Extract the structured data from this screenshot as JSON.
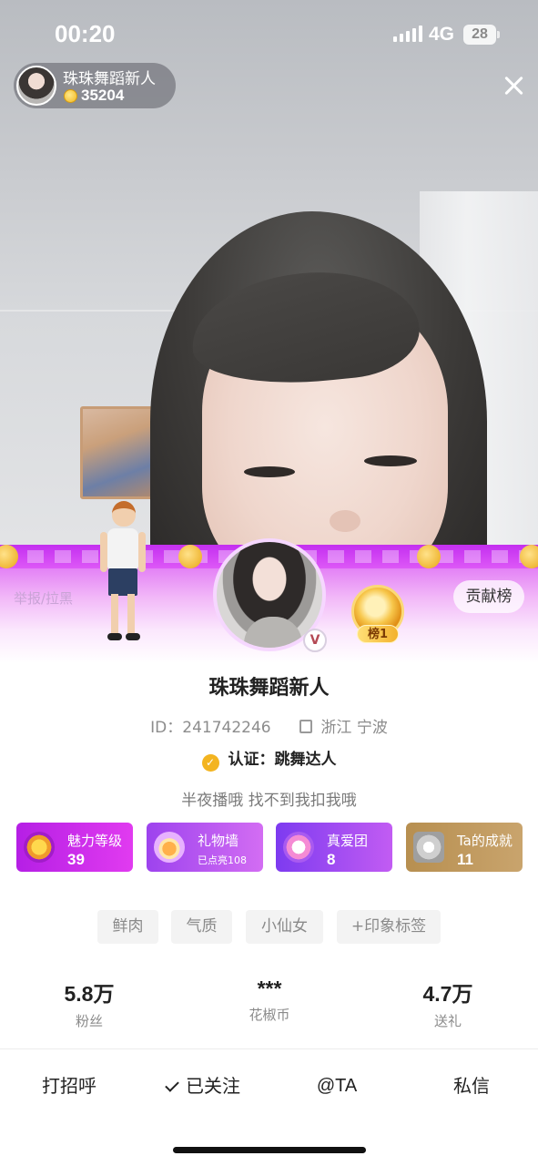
{
  "status_bar": {
    "time": "00:20",
    "network": "4G",
    "battery": "28"
  },
  "host": {
    "name": "珠珠舞蹈新人",
    "coins": "35204"
  },
  "banner": {
    "report_label": "举报/拉黑",
    "rank_label": "榜1",
    "contrib_label": "贡献榜",
    "vip_mark": "V"
  },
  "profile": {
    "name": "珠珠舞蹈新人",
    "id_text": "ID：241742246",
    "location": "浙江 宁波",
    "cert_text": "认证：跳舞达人",
    "bio": "半夜播哦 找不到我扣我哦"
  },
  "cards": [
    {
      "title": "魅力等级",
      "value": "39"
    },
    {
      "title": "礼物墙",
      "value": "已点亮108"
    },
    {
      "title": "真爱团",
      "value": "8"
    },
    {
      "title": "Ta的成就",
      "value": "11"
    }
  ],
  "tags": [
    "鲜肉",
    "气质",
    "小仙女",
    "+印象标签"
  ],
  "stats": [
    {
      "value": "5.8万",
      "label": "粉丝"
    },
    {
      "value": "***",
      "label": "花椒币"
    },
    {
      "value": "4.7万",
      "label": "送礼"
    }
  ],
  "actions": {
    "greet": "打招呼",
    "followed": "已关注",
    "mention": "@TA",
    "message": "私信"
  },
  "colors": {
    "banner_primary": "#d54bf2",
    "charm_card": "#b51fe5",
    "achieve_card": "#b78f50",
    "cert_badge": "#f3b420"
  }
}
